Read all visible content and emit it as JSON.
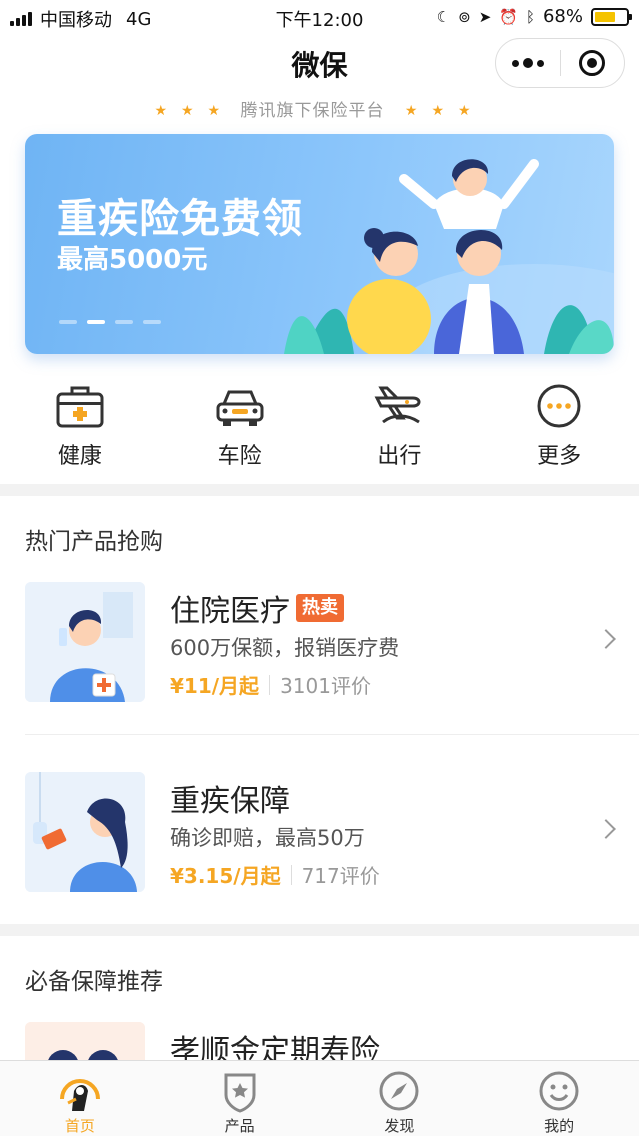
{
  "status_bar": {
    "carrier": "中国移动",
    "network": "4G",
    "time": "下午12:00",
    "battery_percent": "68%",
    "battery_level": 0.68,
    "icons": [
      "moon-icon",
      "orientation-lock-icon",
      "location-arrow-icon",
      "alarm-icon",
      "bluetooth-icon"
    ]
  },
  "header": {
    "title": "微保",
    "more_icon": "more-dots-icon",
    "close_icon": "target-icon",
    "tagline": "腾讯旗下保险平台"
  },
  "banner": {
    "title": "重疾险免费领",
    "subtitle": "最高5000元",
    "slide_count": 4,
    "active_slide": 2
  },
  "categories": [
    {
      "label": "健康",
      "icon": "medical-kit-icon"
    },
    {
      "label": "车险",
      "icon": "car-icon"
    },
    {
      "label": "出行",
      "icon": "plane-icon"
    },
    {
      "label": "更多",
      "icon": "more-circle-icon"
    }
  ],
  "hot_section": {
    "title": "热门产品抢购",
    "products": [
      {
        "name": "住院医疗",
        "badge": "热卖",
        "desc": "600万保额，报销医疗费",
        "price": "¥11/月起",
        "reviews": "3101评价"
      },
      {
        "name": "重疾保障",
        "badge": "",
        "desc": "确诊即赔，最高50万",
        "price": "¥3.15/月起",
        "reviews": "717评价"
      }
    ]
  },
  "recommend_section": {
    "title": "必备保障推荐",
    "products": [
      {
        "name": "孝顺金定期寿险"
      }
    ]
  },
  "tabbar": {
    "tabs": [
      {
        "label": "首页",
        "icon": "home-icon",
        "active": true
      },
      {
        "label": "产品",
        "icon": "product-shield-icon",
        "active": false
      },
      {
        "label": "发现",
        "icon": "compass-icon",
        "active": false
      },
      {
        "label": "我的",
        "icon": "smile-face-icon",
        "active": false
      }
    ]
  },
  "colors": {
    "accent": "#f5a623",
    "hot_badge": "#f06b33",
    "banner_blue": "#6fb4f4"
  }
}
